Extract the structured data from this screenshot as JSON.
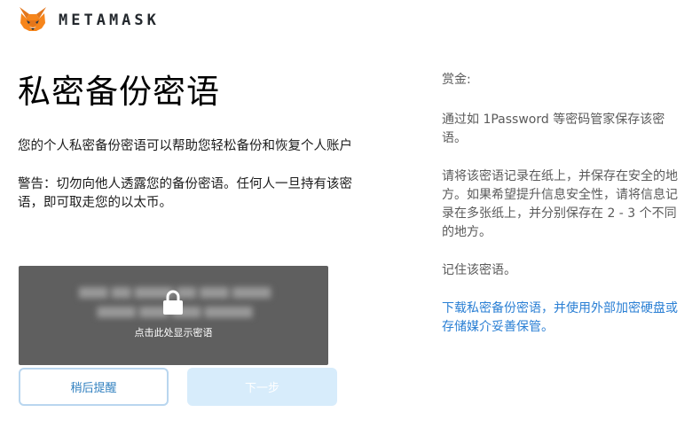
{
  "header": {
    "brand": "METAMASK"
  },
  "main": {
    "title": "私密备份密语",
    "intro": "您的个人私密备份密语可以帮助您轻松备份和恢复个人账户",
    "warning": "警告：切勿向他人透露您的备份密语。任何人一旦持有该密语，即可取走您的以太币。"
  },
  "secret": {
    "reveal_label": "点击此处显示密语"
  },
  "buttons": {
    "remind_later": "稍后提醒",
    "next": "下一步"
  },
  "tips": {
    "title": "赏金:",
    "items": [
      "通过如 1Password 等密码管家保存该密语。",
      "请将该密语记录在纸上，并保存在安全的地方。如果希望提升信息安全性，请将信息记录在多张纸上，并分别保存在 2 - 3 个不同的地方。",
      "记住该密语。"
    ],
    "download_link": "下载私密备份密语，并使用外部加密硬盘或存储媒介妥善保管。"
  },
  "colors": {
    "accent": "#2a7fd4",
    "secret_box_bg": "#5f5f5f",
    "next_button_disabled": "#d7ecfb"
  }
}
